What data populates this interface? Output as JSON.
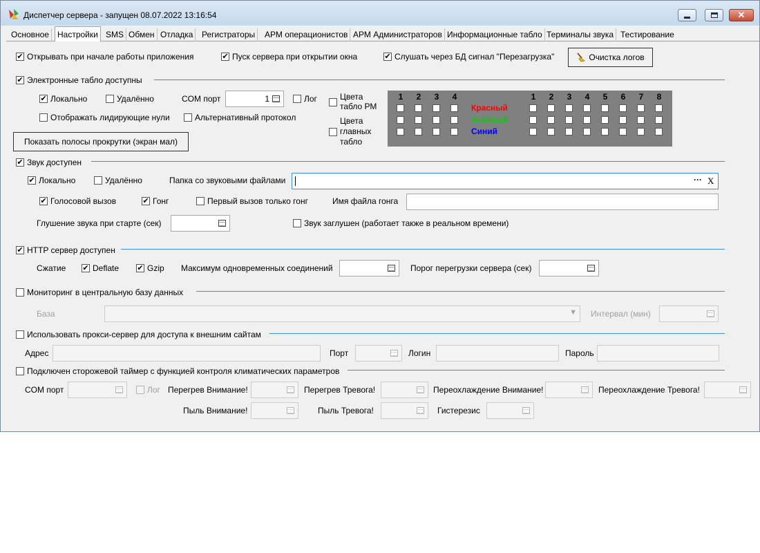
{
  "window": {
    "title": "Диспетчер сервера - запущен 08.07.2022 13:16:54",
    "accent_color": "#3b8fd4"
  },
  "tabs": [
    "Основное",
    "Настройки",
    "SMS",
    "Обмен",
    "Отладка",
    "Регистраторы",
    "АРМ операционистов",
    "АРМ Администраторов",
    "Информационные табло",
    "Терминалы звука",
    "Тестирование"
  ],
  "active_tab": "Настройки",
  "top": {
    "open_on_start": "Открывать при начале работы приложения",
    "start_server_on_open": "Пуск сервера при открытии окна",
    "listen_reload": "Слушать через БД сигнал \"Перезагрузка\"",
    "clear_logs": "Очистка логов"
  },
  "boards": {
    "heading": "Электронные табло доступны",
    "local": "Локально",
    "remote": "Удалённо",
    "com_port_label": "COM порт",
    "com_port_value": "1",
    "log": "Лог",
    "leading_zeros": "Отображать лидирующие нули",
    "alt_protocol": "Альтернативный протокол",
    "colors_rm": [
      "Цвета",
      "табло РМ"
    ],
    "colors_main": [
      "Цвета",
      "главных",
      "табло"
    ],
    "show_scrollbars": "Показать полосы прокрутки (экран мал)",
    "grid": {
      "left_numbers": [
        "1",
        "2",
        "3",
        "4"
      ],
      "right_numbers": [
        "1",
        "2",
        "3",
        "4",
        "5",
        "6",
        "7",
        "8"
      ],
      "color_labels": [
        {
          "text": "Красный",
          "color": "#ff0000"
        },
        {
          "text": "Зелёный",
          "color": "#00d000"
        },
        {
          "text": "Синий",
          "color": "#0000ff"
        }
      ]
    }
  },
  "sound": {
    "heading": "Звук доступен",
    "local": "Локально",
    "remote": "Удалённо",
    "folder_label": "Папка со звуковыми файлами",
    "folder_value": "",
    "browse": "···",
    "clear": "X",
    "voice_call": "Голосовой вызов",
    "gong": "Гонг",
    "first_call_gong": "Первый вызов только гонг",
    "gong_file_label": "Имя файла гонга",
    "gong_file_value": "",
    "mute_at_start_label": "Глушение звука при старте (сек)",
    "mute_at_start_value": "",
    "muted": "Звук заглушен (работает также в реальном времени)"
  },
  "http": {
    "heading": "HTTP сервер доступен",
    "compression": "Сжатие",
    "deflate": "Deflate",
    "gzip": "Gzip",
    "max_conn_label": "Максимум одновременных соединений",
    "max_conn_value": "",
    "overload_label": "Порог перегрузки сервера (сек)",
    "overload_value": ""
  },
  "monitoring": {
    "heading": "Мониторинг в центральную базу данных",
    "db_label": "База",
    "db_value": "",
    "interval_label": "Интервал (мин)",
    "interval_value": ""
  },
  "proxy": {
    "heading": "Использовать прокси-сервер для доступа к внешним сайтам",
    "address_label": "Адрес",
    "port_label": "Порт",
    "login_label": "Логин",
    "password_label": "Пароль"
  },
  "watchdog": {
    "heading": "Подключен сторожевой таймер с функцией контроля климатических параметров",
    "com_port": "COM порт",
    "log": "Лог",
    "overheat_warn": "Перегрев Внимание!",
    "overheat_alarm": "Перегрев Тревога!",
    "overcool_warn": "Переохлаждение Внимание!",
    "overcool_alarm": "Переохлаждение Тревога!",
    "dust_warn": "Пыль Внимание!",
    "dust_alarm": "Пыль Тревога!",
    "hysteresis": "Гистерезис"
  }
}
